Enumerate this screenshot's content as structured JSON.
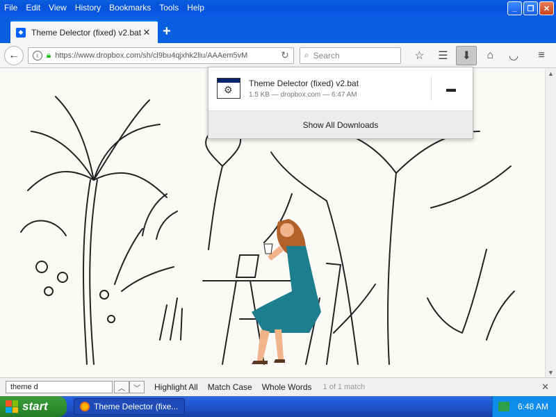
{
  "menu": [
    "File",
    "Edit",
    "View",
    "History",
    "Bookmarks",
    "Tools",
    "Help"
  ],
  "tab": {
    "title": "Theme Delector (fixed) v2.bat"
  },
  "nav": {
    "url": "https://www.dropbox.com/sh/cl9bu4qjxhk2liu/AAAem5vM",
    "search_placeholder": "Search"
  },
  "download": {
    "filename": "Theme Delector (fixed) v2.bat",
    "meta": "1.5 KB — dropbox.com — 6:47 AM",
    "show_all": "Show All Downloads"
  },
  "findbar": {
    "query": "theme d",
    "highlight_all": "Highlight All",
    "match_case": "Match Case",
    "whole_words": "Whole Words",
    "count": "1 of 1 match"
  },
  "taskbar": {
    "start": "start",
    "task": "Theme Delector (fixe...",
    "time": "6:48 AM"
  },
  "colors": {
    "xp_blue": "#0a5fe0",
    "start_green": "#2f8f2f",
    "tray_blue": "#0f8cec"
  }
}
